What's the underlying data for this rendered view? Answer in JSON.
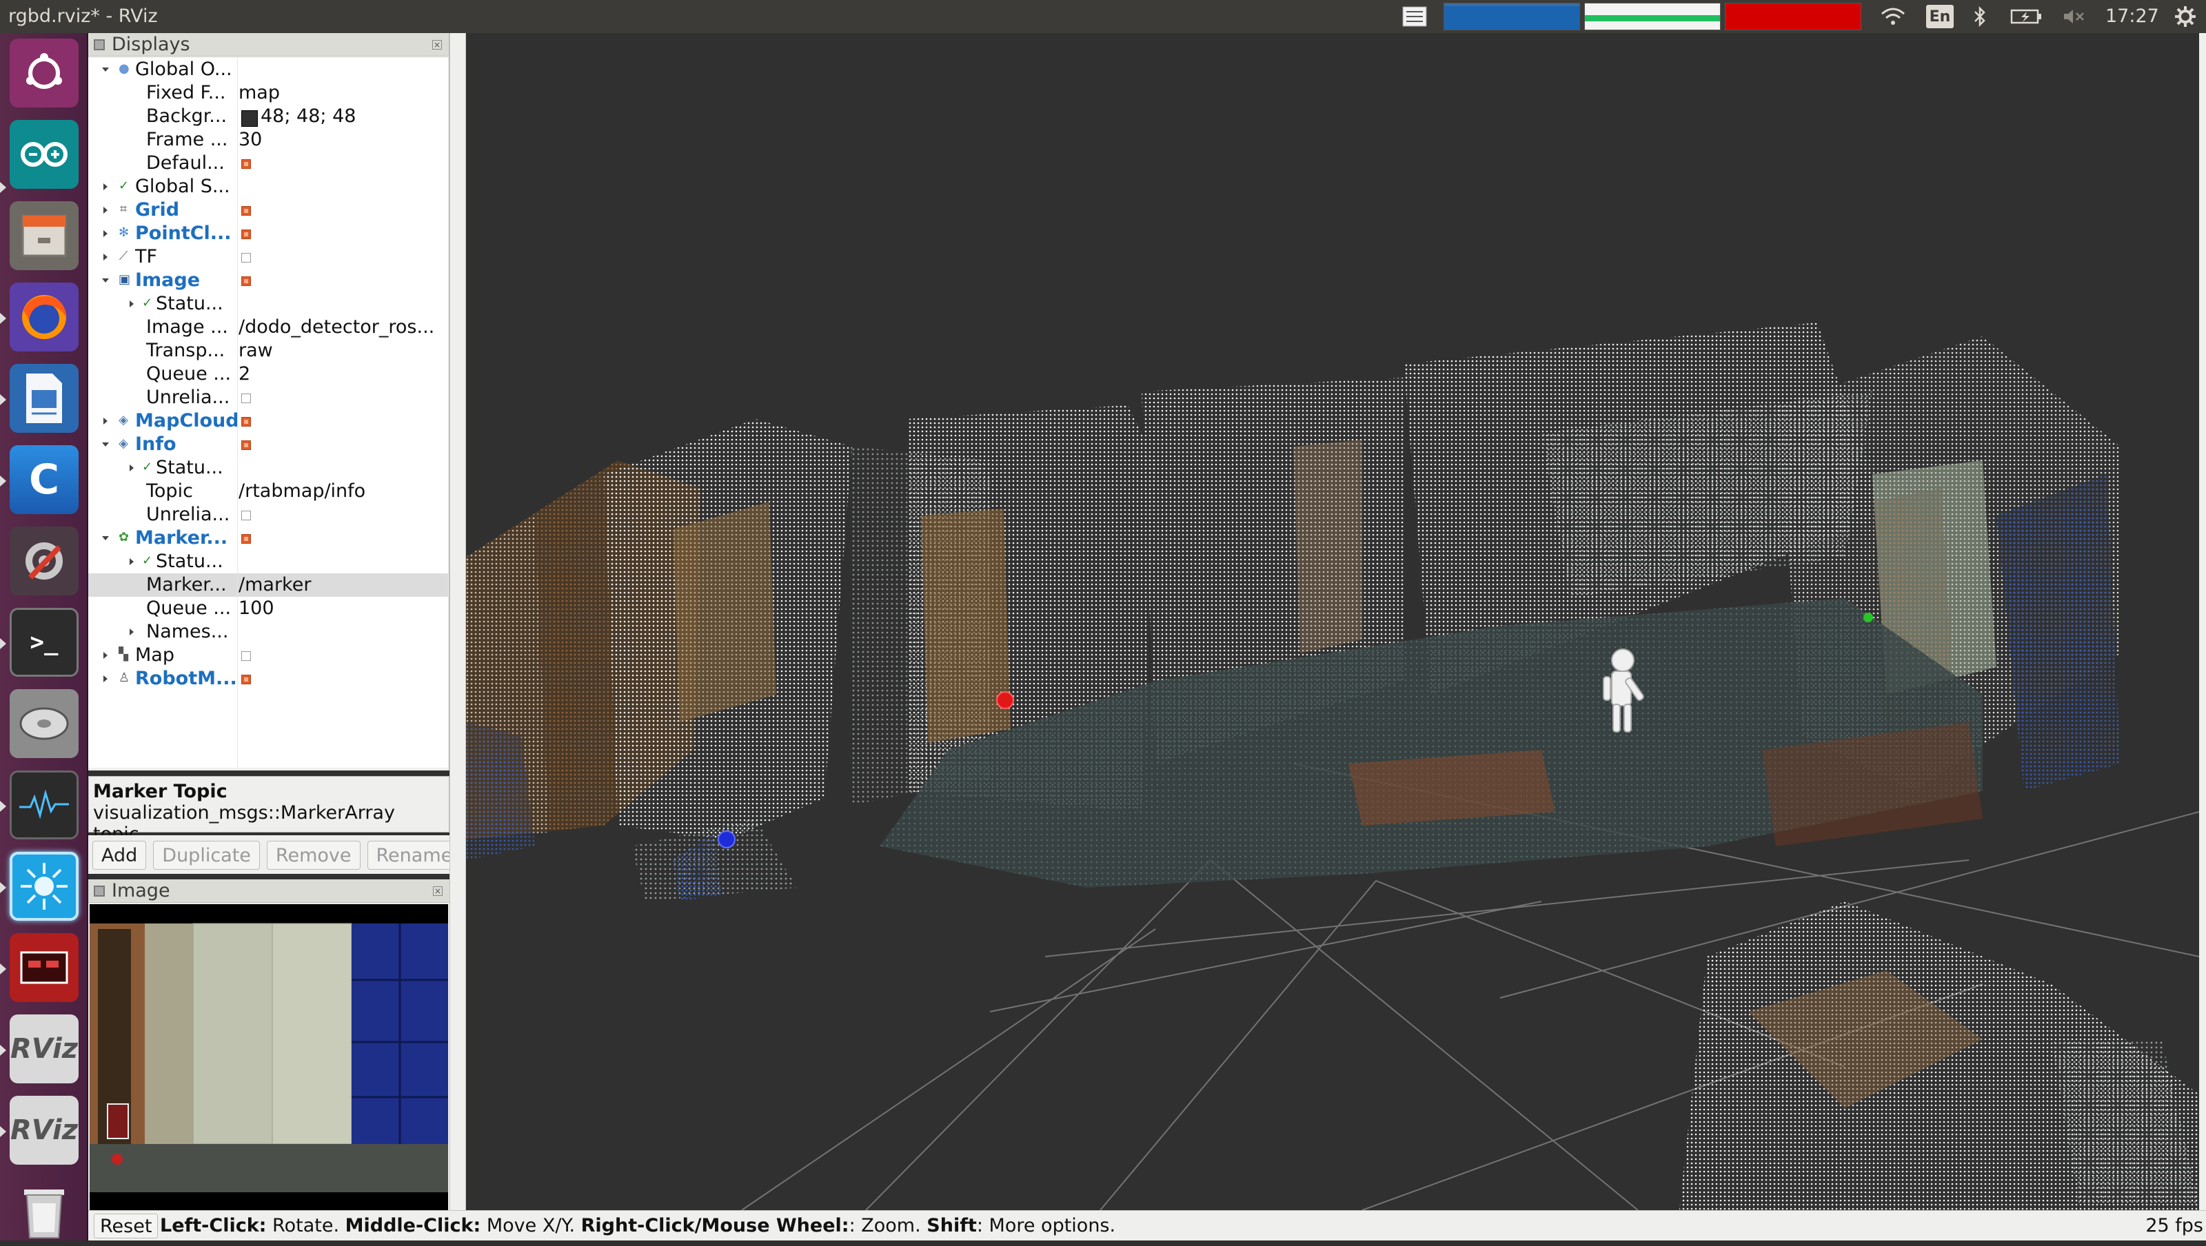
{
  "window": {
    "title": "rgbd.rviz* - RViz"
  },
  "topbar": {
    "lang": "En",
    "clock": "17:27"
  },
  "launcher": {
    "items": [
      {
        "name": "ubuntu-dash-icon",
        "label": ""
      },
      {
        "name": "arduino-icon",
        "label": ""
      },
      {
        "name": "files-icon",
        "label": ""
      },
      {
        "name": "firefox-icon",
        "label": ""
      },
      {
        "name": "writer-icon",
        "label": ""
      },
      {
        "name": "clion-icon",
        "label": "C"
      },
      {
        "name": "settings-icon",
        "label": ""
      },
      {
        "name": "terminal-icon",
        "label": ">_"
      },
      {
        "name": "disk-icon",
        "label": ""
      },
      {
        "name": "system-monitor-icon",
        "label": ""
      },
      {
        "name": "rviz-active-icon",
        "label": ""
      },
      {
        "name": "screen-recorder-icon",
        "label": ""
      },
      {
        "name": "rviz-icon-1",
        "label": "RViz"
      },
      {
        "name": "rviz-icon-2",
        "label": "RViz"
      },
      {
        "name": "trash-icon",
        "label": ""
      }
    ]
  },
  "displays": {
    "title": "Displays",
    "rows": [
      {
        "name": "Global O...",
        "value": "",
        "type": "group"
      },
      {
        "name": "Fixed F...",
        "value": "map"
      },
      {
        "name": "Backgr...",
        "value": "48; 48; 48"
      },
      {
        "name": "Frame ...",
        "value": "30"
      },
      {
        "name": "Defaul...",
        "value": ""
      },
      {
        "name": "Global S...",
        "value": ""
      },
      {
        "name": "Grid",
        "value": ""
      },
      {
        "name": "PointCl...",
        "value": ""
      },
      {
        "name": "TF",
        "value": ""
      },
      {
        "name": "Image",
        "value": ""
      },
      {
        "name": "Statu...",
        "value": ""
      },
      {
        "name": "Image ...",
        "value": "/dodo_detector_ros..."
      },
      {
        "name": "Transp...",
        "value": "raw"
      },
      {
        "name": "Queue ...",
        "value": "2"
      },
      {
        "name": "Unrelia...",
        "value": ""
      },
      {
        "name": "MapCloud",
        "value": ""
      },
      {
        "name": "Info",
        "value": ""
      },
      {
        "name": "Statu...",
        "value": ""
      },
      {
        "name": "Topic",
        "value": "/rtabmap/info"
      },
      {
        "name": "Unrelia...",
        "value": ""
      },
      {
        "name": "Marker...",
        "value": ""
      },
      {
        "name": "Statu...",
        "value": ""
      },
      {
        "name": "Marker...",
        "value": "/marker"
      },
      {
        "name": "Queue ...",
        "value": "100"
      },
      {
        "name": "Names...",
        "value": ""
      },
      {
        "name": "Map",
        "value": ""
      },
      {
        "name": "RobotM...",
        "value": ""
      }
    ]
  },
  "description": {
    "title": "Marker Topic",
    "text": "visualization_msgs::MarkerArray topic"
  },
  "buttons": {
    "add": "Add",
    "duplicate": "Duplicate",
    "remove": "Remove",
    "rename": "Rename"
  },
  "image_panel": {
    "title": "Image"
  },
  "statusbar": {
    "reset": "Reset",
    "hint_b1": "Left-Click:",
    "hint_t1": " Rotate. ",
    "hint_b2": "Middle-Click:",
    "hint_t2": " Move X/Y. ",
    "hint_b3": "Right-Click/Mouse Wheel:",
    "hint_t3": ": Zoom. ",
    "hint_b4": "Shift",
    "hint_t4": ": More options.",
    "fps": "25 fps"
  },
  "colors": {
    "background": "#303030",
    "accent": "#1d6fc0",
    "checkbox_on": "#e25b2a"
  }
}
